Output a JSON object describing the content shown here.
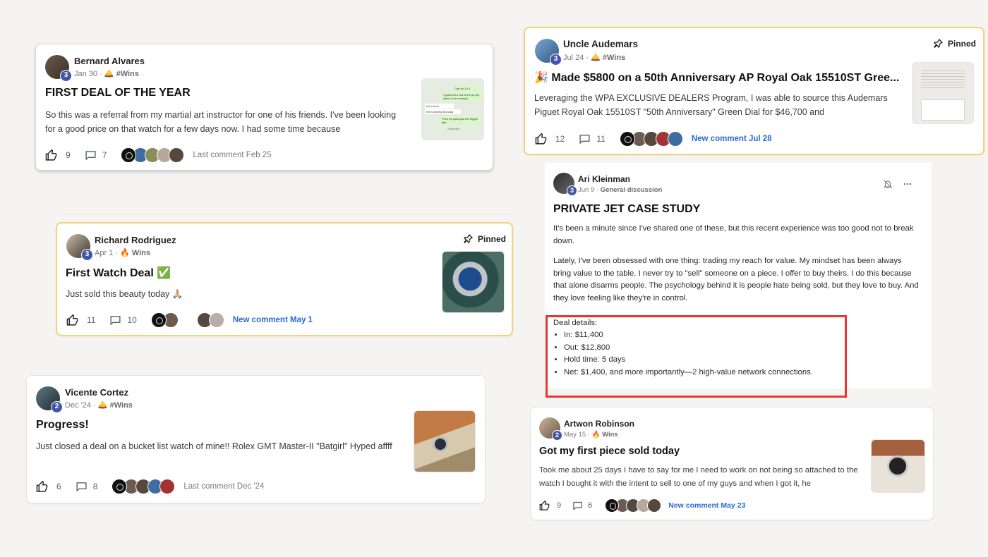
{
  "posts": {
    "bernard": {
      "author": "Bernard Alvares",
      "level": "3",
      "date": "Jan 30",
      "category": "#Wins",
      "title": "FIRST DEAL OF THE YEAR",
      "body": "So this was a referral from my martial art instructor for one of his friends. I've been looking for a good price on that watch for a few days now. I had some time because",
      "likes": "9",
      "comments": "7",
      "activity": "Last comment Feb 25",
      "thumb_lines": [
        "Can do 13.5",
        "I guess he's not in the us yet, when is he coming?",
        "He is here",
        "He is leaving Monday",
        "Then he gotta pull the trigger fast",
        "Yesterday"
      ]
    },
    "uncle": {
      "author": "Uncle Audemars",
      "level": "3",
      "date": "Jul 24",
      "category": "#Wins",
      "pinned_label": "Pinned",
      "title": "🎉 Made $5800 on a 50th Anniversary AP Royal Oak 15510ST Gree...",
      "body": "Leveraging the WPA EXCLUSIVE DEALERS Program, I was able to source this Audemars Piguet Royal Oak 15510ST \"50th Anniversary\" Green Dial for $46,700 and",
      "likes": "12",
      "comments": "11",
      "activity": "New comment Jul 28"
    },
    "richard": {
      "author": "Richard Rodriguez",
      "level": "3",
      "date": "Apr 1",
      "category": "🔥 Wins",
      "pinned_label": "Pinned",
      "title": "First Watch Deal ✅",
      "body": "Just sold this beauty today 🙏🏼",
      "likes": "11",
      "comments": "10",
      "activity": "New comment May 1"
    },
    "ari": {
      "author": "Ari Kleinman",
      "level": "3",
      "date": "Jun 9",
      "category": "General discussion",
      "title": "PRIVATE JET CASE STUDY",
      "para1": "It's been a minute since I've shared one of these, but this recent experience was too good not to break down.",
      "para2": "Lately, I've been obsessed with one thing: trading my reach for value. My mindset has been always bring value to the table. I never try to \"sell\" someone on a piece. I offer to buy theirs. I do this because that alone disarms people. The psychology behind it is people hate being sold, but they love to buy. And they love feeling like they're in control.",
      "deal_heading": "Deal details:",
      "deal_items": [
        "In: $11,400",
        "Out: $12,800",
        "Hold time: 5 days",
        "Net: $1,400, and more importantly—2 high-value network connections."
      ]
    },
    "vicente": {
      "author": "Vicente Cortez",
      "level": "2",
      "date": "Dec '24",
      "category": "#Wins",
      "title": "Progress!",
      "body": "Just closed a deal on a bucket list watch of mine!! Rolex GMT Master-II \"Batgirl\" Hyped affff",
      "likes": "6",
      "comments": "8",
      "activity": "Last comment Dec '24"
    },
    "artwon": {
      "author": "Artwon Robinson",
      "level": "2",
      "date": "May 15",
      "category": "🔥 Wins",
      "title": "Got my first piece sold today",
      "body": "Took me about 25 days I have to say for me I need to work on not being so attached to the watch I bought it with the intent to sell to one of my guys and when I got it, he",
      "likes": "9",
      "comments": "6",
      "activity": "New comment May 23"
    }
  },
  "colors": {
    "pinned_border": "#f3d27a",
    "level_badge": "#4455a8",
    "new_comment": "#2a6ad6",
    "highlight_box": "#e5362f"
  },
  "icons": [
    "thumbs-up-icon",
    "comment-icon",
    "pin-icon",
    "bell-icon",
    "more-icon"
  ]
}
